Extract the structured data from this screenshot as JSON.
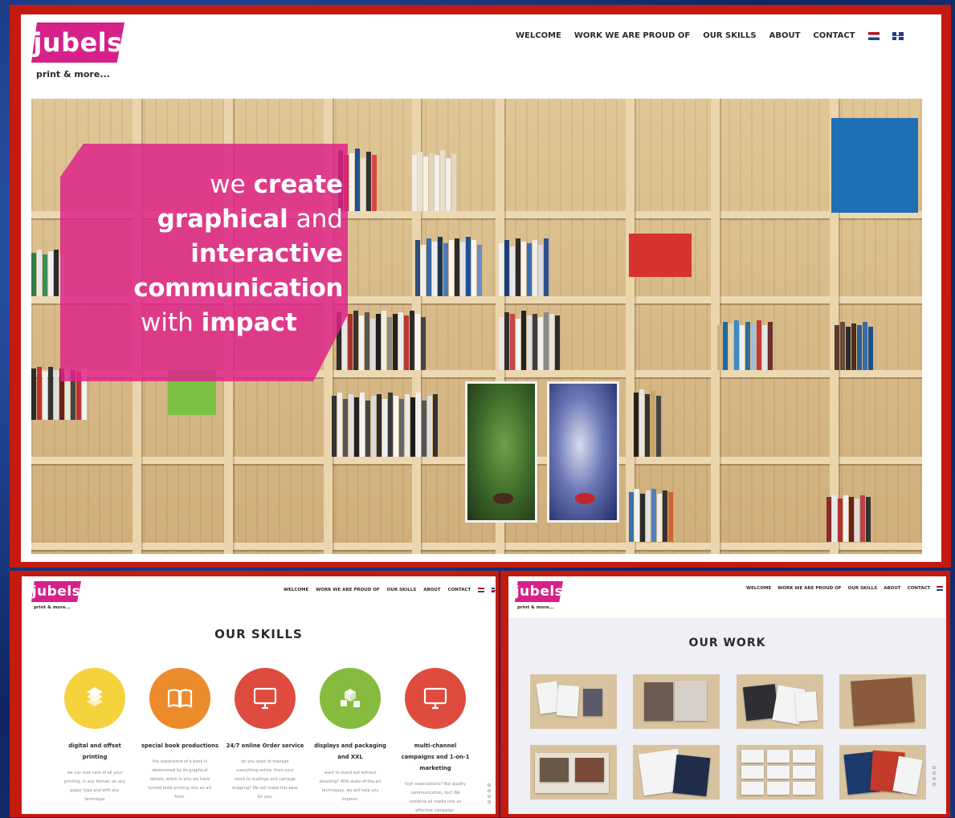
{
  "brand": {
    "logo_text": "jubels",
    "tagline": "print & more..."
  },
  "nav": {
    "items": [
      "WELCOME",
      "WORK WE ARE PROUD OF",
      "OUR SKILLS",
      "ABOUT",
      "CONTACT"
    ],
    "flags": [
      "flag-nl-icon",
      "flag-en-icon"
    ]
  },
  "hero": {
    "lines": [
      {
        "light": "we ",
        "bold": "create"
      },
      {
        "bold": "graphical",
        "light": " and"
      },
      {
        "bold": "interactive"
      },
      {
        "bold": "communication"
      },
      {
        "light": "with ",
        "bold": "impact"
      }
    ]
  },
  "skills": {
    "title": "OUR SKILLS",
    "items": [
      {
        "icon": "pages-fan-icon",
        "color": "#f4d23c",
        "title_1": "digital and offset",
        "title_2": "printing",
        "title_3": "",
        "desc": [
          "we can look care of all your",
          "printing, in any format, on any",
          "paper type and with any",
          "technique"
        ]
      },
      {
        "icon": "open-book-icon",
        "color": "#ec8b2c",
        "title_1": "special book productions",
        "title_2": "",
        "title_3": "",
        "desc": [
          "the experience of a book is",
          "determined by its graphical",
          "details, which is why we have",
          "turned book printing into an art",
          "form."
        ]
      },
      {
        "icon": "monitor-icon",
        "color": "#df4b3e",
        "title_1": "24/7 online Order service",
        "title_2": "",
        "title_3": "",
        "desc": [
          "do you want to manage",
          "everything online, from your",
          "stock to mailings and carriage",
          "shipping? We will make this easy",
          "for you."
        ]
      },
      {
        "icon": "cubes-icon",
        "color": "#86bb3d",
        "title_1": "displays and packaging",
        "title_2": "and XXL",
        "title_3": "",
        "desc": [
          "want to stand out without",
          "shouting? With state-of-the-art",
          "techniques, we will help you",
          "impress."
        ]
      },
      {
        "icon": "monitor-icon",
        "color": "#df4b3e",
        "title_1": "multi-channel",
        "title_2": "campaigns and 1-on-1",
        "title_3": "marketing",
        "desc": [
          "high expectations? But quality",
          "communication, too! We",
          "combine all media into an",
          "effective campaign."
        ]
      }
    ]
  },
  "work": {
    "title": "OUR WORK",
    "thumbs": [
      "brochures-thumb",
      "catalog-people-thumb",
      "dark-booklets-thumb",
      "book-cover-thumb",
      "book-spread-thumb",
      "magazine-thumb",
      "cards-grid-thumb",
      "flyers-thumb"
    ]
  }
}
